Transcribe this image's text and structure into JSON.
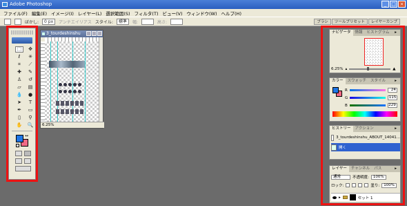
{
  "window": {
    "title": "Adobe Photoshop"
  },
  "menubar": [
    {
      "label": "ファイル(F)"
    },
    {
      "label": "編集(E)"
    },
    {
      "label": "イメージ(I)"
    },
    {
      "label": "レイヤー(L)"
    },
    {
      "label": "選択範囲(S)"
    },
    {
      "label": "フィルタ(T)"
    },
    {
      "label": "ビュー(V)"
    },
    {
      "label": "ウィンドウ(W)"
    },
    {
      "label": "ヘルプ(H)"
    }
  ],
  "options": {
    "feather_label": "ぼかし:",
    "feather_value": "0 px",
    "antialias_label": "アンチエイリアス",
    "style_label": "スタイル:",
    "style_value": "標準",
    "width_label": "幅:",
    "height_label": "高さ:",
    "wells": [
      "ブラシ",
      "ツールプリセット",
      "レイヤーカンプ"
    ]
  },
  "toolbox": {
    "tools": [
      {
        "name": "marquee-tool",
        "glyph": "⬚",
        "active": true
      },
      {
        "name": "move-tool",
        "glyph": "✥"
      },
      {
        "name": "lasso-tool",
        "glyph": "ℓ"
      },
      {
        "name": "magic-wand-tool",
        "glyph": "✳"
      },
      {
        "name": "crop-tool",
        "glyph": "⌗"
      },
      {
        "name": "slice-tool",
        "glyph": "⟋"
      },
      {
        "name": "healing-brush-tool",
        "glyph": "✚"
      },
      {
        "name": "brush-tool",
        "glyph": "✎"
      },
      {
        "name": "clone-stamp-tool",
        "glyph": "♙"
      },
      {
        "name": "history-brush-tool",
        "glyph": "↺"
      },
      {
        "name": "eraser-tool",
        "glyph": "▱"
      },
      {
        "name": "gradient-tool",
        "glyph": "▤"
      },
      {
        "name": "blur-tool",
        "glyph": "💧"
      },
      {
        "name": "dodge-tool",
        "glyph": "●"
      },
      {
        "name": "path-selection-tool",
        "glyph": "➤"
      },
      {
        "name": "type-tool",
        "glyph": "T"
      },
      {
        "name": "pen-tool",
        "glyph": "✒"
      },
      {
        "name": "shape-tool",
        "glyph": "▭"
      },
      {
        "name": "notes-tool",
        "glyph": "▯"
      },
      {
        "name": "eyedropper-tool",
        "glyph": "⚲"
      },
      {
        "name": "hand-tool",
        "glyph": "✋"
      },
      {
        "name": "zoom-tool",
        "glyph": "🔍"
      }
    ],
    "foreground_color": "#1f76e6",
    "background_color": "#f06a86"
  },
  "document": {
    "title": "3_tourdeshinshu",
    "zoom": "6.25%"
  },
  "navigator": {
    "tabs": [
      "ナビゲータ",
      "情報",
      "ヒストグラム"
    ],
    "zoom": "6.25%"
  },
  "color_panel": {
    "tabs": [
      "カラー",
      "スウォッチ",
      "スタイル"
    ],
    "channels": [
      {
        "label": "R",
        "value": "24"
      },
      {
        "label": "G",
        "value": "115"
      },
      {
        "label": "B",
        "value": "229"
      }
    ]
  },
  "history_panel": {
    "tabs": [
      "ヒストリー",
      "アクション"
    ],
    "snapshot": "3_tourdeshinshu_ABOUT_14041...",
    "step": "開く"
  },
  "layers_panel": {
    "tabs": [
      "レイヤー",
      "チャンネル",
      "パス"
    ],
    "blend_mode": "通常",
    "opacity_label": "不透明度:",
    "opacity_value": "100%",
    "lock_label": "ロック:",
    "fill_label": "塗り:",
    "fill_value": "100%",
    "layer_name": "セット 1"
  }
}
